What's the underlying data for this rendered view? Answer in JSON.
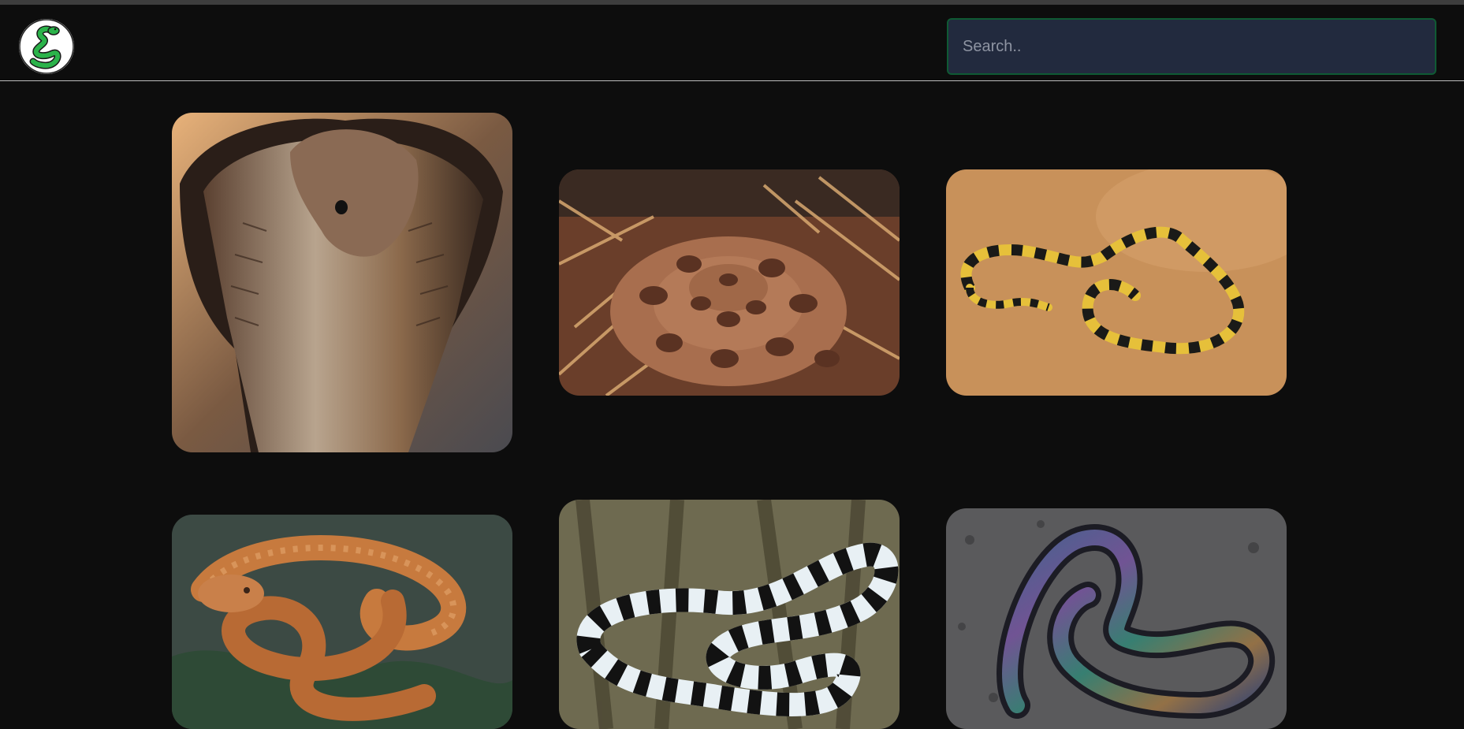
{
  "header": {
    "logo": {
      "icon": "snake-logo-icon",
      "brand_color": "#2bb34a"
    },
    "search": {
      "placeholder": "Search..",
      "value": ""
    }
  },
  "gallery": {
    "cards": [
      {
        "subject": "cobra-hood",
        "icon": "cobra-photo"
      },
      {
        "subject": "viper-coiled-in-straw",
        "icon": "viper-photo"
      },
      {
        "subject": "banded-krait-on-sand",
        "icon": "krait-photo"
      },
      {
        "subject": "orange-cat-snake",
        "icon": "orange-snake-photo"
      },
      {
        "subject": "sea-krait-black-white",
        "icon": "sea-krait-photo"
      },
      {
        "subject": "iridescent-sunbeam-snake",
        "icon": "sunbeam-snake-photo"
      }
    ]
  },
  "colors": {
    "background": "#0d0d0d",
    "search_bg": "#222a3e",
    "search_border": "#0f5a34",
    "divider": "#bdbdbd"
  }
}
